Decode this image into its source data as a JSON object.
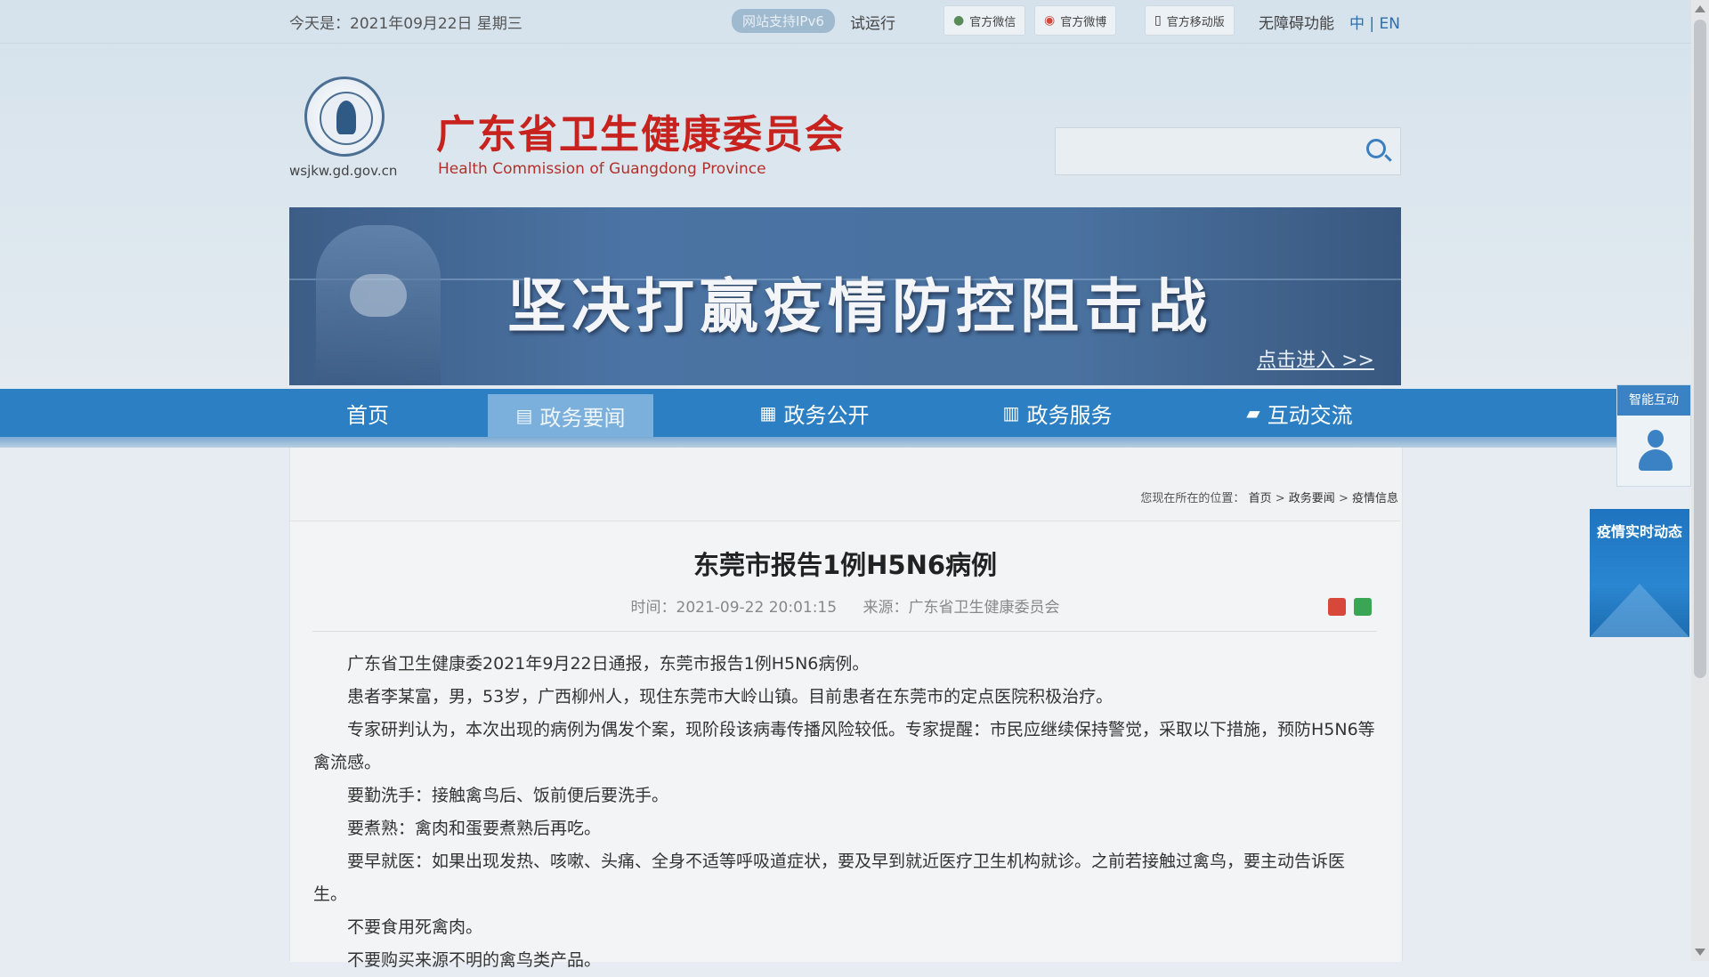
{
  "topbar": {
    "date": "今天是：2021年09月22日 星期三",
    "ipv6": "网站支持IPv6",
    "trial": "试运行",
    "wechat": "官方微信",
    "weibo": "官方微博",
    "mobile": "官方移动版",
    "accessibility": "无障碍功能",
    "lang": "中 | EN"
  },
  "header": {
    "domain": "wsjkw.gd.gov.cn",
    "org_cn": "广东省卫生健康委员会",
    "org_en": "Health Commission of Guangdong Province",
    "search_placeholder": ""
  },
  "banner": {
    "title": "坚决打赢疫情防控阻击战",
    "enter": "点击进入 >>"
  },
  "nav": {
    "items": [
      {
        "label": "首页"
      },
      {
        "label": "政务要闻"
      },
      {
        "label": "政务公开"
      },
      {
        "label": "政务服务"
      },
      {
        "label": "互动交流"
      }
    ],
    "active_index": 1
  },
  "breadcrumb": {
    "prefix": "您现在所在的位置：",
    "home": "首页",
    "sep": ">",
    "section": "政务要闻",
    "current": "疫情信息"
  },
  "article": {
    "title": "东莞市报告1例H5N6病例",
    "time": "时间：2021-09-22 20:01:15",
    "source": "来源：广东省卫生健康委员会",
    "paragraphs": [
      "广东省卫生健康委2021年9月22日通报，东莞市报告1例H5N6病例。",
      "患者李某富，男，53岁，广西柳州人，现住东莞市大岭山镇。目前患者在东莞市的定点医院积极治疗。",
      "专家研判认为，本次出现的病例为偶发个案，现阶段该病毒传播风险较低。专家提醒：市民应继续保持警觉，采取以下措施，预防H5N6等禽流感。",
      "要勤洗手：接触禽鸟后、饭前便后要洗手。",
      "要煮熟：禽肉和蛋要煮熟后再吃。",
      "要早就医：如果出现发热、咳嗽、头痛、全身不适等呼吸道症状，要及早到就近医疗卫生机构就诊。之前若接触过禽鸟，要主动告诉医生。",
      "不要食用死禽肉。",
      "不要购买来源不明的禽鸟类产品。"
    ]
  },
  "float": {
    "ai_label": "智能互动",
    "covid_label": "疫情实时动态"
  },
  "colors": {
    "brand_red": "#c7221d",
    "nav_blue": "#2c7fc2",
    "nav_active": "#7cb0dc"
  }
}
